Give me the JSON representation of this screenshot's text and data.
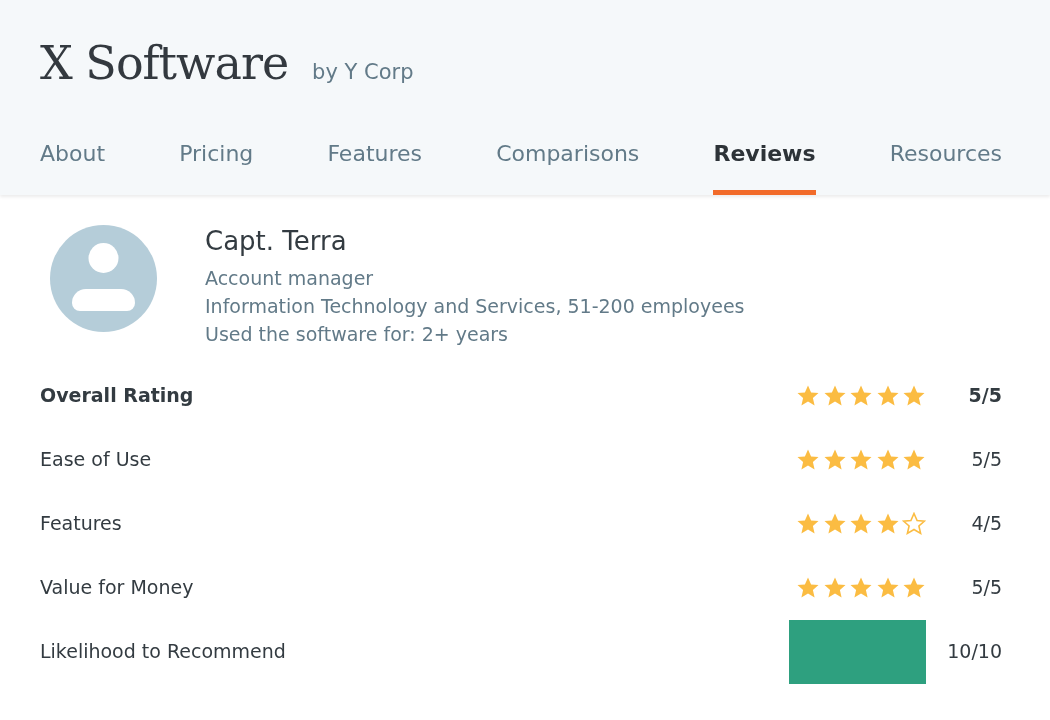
{
  "product": {
    "title": "X Software",
    "vendor": "by Y Corp"
  },
  "tabs": [
    {
      "label": "About",
      "selected": false
    },
    {
      "label": "Pricing",
      "selected": false
    },
    {
      "label": "Features",
      "selected": false
    },
    {
      "label": "Comparisons",
      "selected": false
    },
    {
      "label": "Reviews",
      "selected": true
    },
    {
      "label": "Resources",
      "selected": false
    }
  ],
  "reviewer": {
    "name": "Capt. Terra",
    "role": "Account manager",
    "company": "Information Technology and Services, 51-200 employees",
    "usage": "Used the software for: 2+ years"
  },
  "ratings": [
    {
      "kind": "overall",
      "label": "Overall Rating",
      "stars": 5,
      "score": "5/5"
    },
    {
      "kind": "stars",
      "label": "Ease of Use",
      "stars": 5,
      "score": "5/5"
    },
    {
      "kind": "stars",
      "label": "Features",
      "stars": 4,
      "score": "4/5"
    },
    {
      "kind": "stars",
      "label": "Value for Money",
      "stars": 5,
      "score": "5/5"
    },
    {
      "kind": "bar",
      "label": "Likelihood to Recommend",
      "score": "10/10"
    }
  ]
}
